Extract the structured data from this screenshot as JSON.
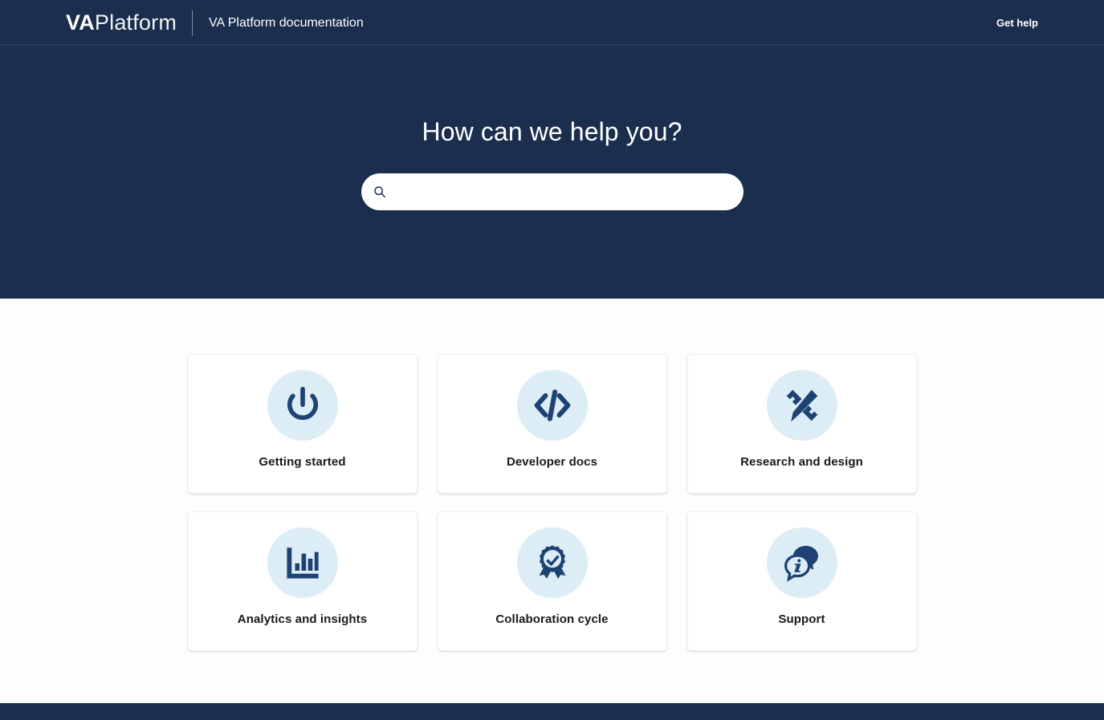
{
  "header": {
    "logo_va": "VA",
    "logo_platform": "Platform",
    "subtitle": "VA Platform documentation",
    "get_help_label": "Get help"
  },
  "hero": {
    "heading": "How can we help you?",
    "search": {
      "value": "",
      "placeholder": "",
      "icon": "search-icon"
    }
  },
  "cards": [
    {
      "label": "Getting started",
      "icon": "power-icon"
    },
    {
      "label": "Developer docs",
      "icon": "code-icon"
    },
    {
      "label": "Research and design",
      "icon": "pencil-ruler-icon"
    },
    {
      "label": "Analytics and insights",
      "icon": "bar-chart-icon"
    },
    {
      "label": "Collaboration cycle",
      "icon": "award-ribbon-icon"
    },
    {
      "label": "Support",
      "icon": "chat-info-icon"
    }
  ],
  "colors": {
    "navy": "#1b2e4d",
    "icon_navy": "#1d4273",
    "icon_circle_bg": "#dcedf6",
    "page_bg": "#fdfdfd",
    "card_bg": "#ffffff"
  }
}
